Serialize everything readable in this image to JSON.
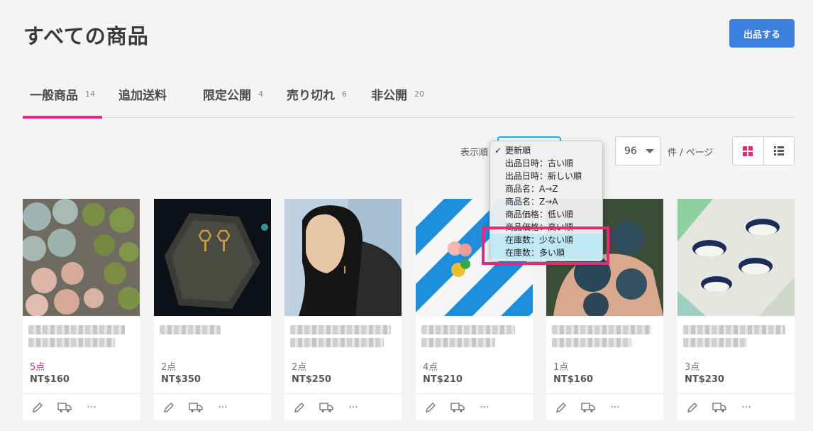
{
  "header": {
    "title": "すべての商品",
    "primary_button": "出品する"
  },
  "tabs": [
    {
      "label": "一般商品",
      "count": "14"
    },
    {
      "label": "追加送料",
      "count": ""
    },
    {
      "label": "限定公開",
      "count": "4"
    },
    {
      "label": "売り切れ",
      "count": "6"
    },
    {
      "label": "非公開",
      "count": "20"
    }
  ],
  "toolbar": {
    "sort_label": "表示順",
    "per_page_value": "96",
    "per_page_label": "件 / ページ"
  },
  "sort_menu": {
    "check": "✓",
    "items": [
      "更新順",
      "出品日時：古い順",
      "出品日時：新しい順",
      "商品名：A→Z",
      "商品名：Z→A",
      "商品価格：低い順",
      "商品価格：高い順",
      "在庫数：少ない順",
      "在庫数：多い順"
    ]
  },
  "products": [
    {
      "qty": "5点",
      "price": "NT$160"
    },
    {
      "qty": "2点",
      "price": "NT$350"
    },
    {
      "qty": "2点",
      "price": "NT$250"
    },
    {
      "qty": "4点",
      "price": "NT$210"
    },
    {
      "qty": "1点",
      "price": "NT$160"
    },
    {
      "qty": "3点",
      "price": "NT$230"
    }
  ],
  "card_actions": {
    "more": "···"
  },
  "colors": {
    "accent": "#e8287b",
    "primary": "#3d7fdd",
    "focus": "#29a9e8"
  }
}
